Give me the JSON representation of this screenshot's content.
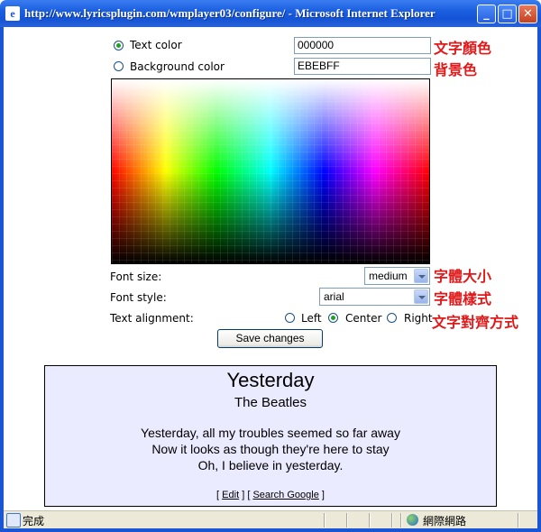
{
  "window": {
    "title": "http://www.lyricsplugin.com/wmplayer03/configure/ - Microsoft Internet Explorer",
    "icon": "ie-icon",
    "controls": {
      "minimize": "_",
      "maximize": "□",
      "close": "✕"
    }
  },
  "colors": {
    "text_color_label": "Text color",
    "text_color_value": "000000",
    "bg_color_label": "Background color",
    "bg_color_value": "EBEBFF",
    "text_color_selected": true
  },
  "font": {
    "size_label": "Font size:",
    "size_value": "medium",
    "style_label": "Font style:",
    "style_value": "arial",
    "align_label": "Text alignment:",
    "align_options": [
      "Left",
      "Center",
      "Right"
    ],
    "align_selected": "Center"
  },
  "save_button": "Save changes",
  "annotations": {
    "text_color": "文字顏色",
    "bg_color": "背景色",
    "font_size": "字體大小",
    "font_style": "字體樣式",
    "text_align": "文字對齊方式"
  },
  "preview": {
    "title": "Yesterday",
    "artist": "The Beatles",
    "lines": [
      "Yesterday, all my troubles seemed so far away",
      "Now it looks as though they're here to stay",
      "Oh, I believe in yesterday."
    ],
    "links_open": "[",
    "edit_link": "Edit",
    "links_mid": "] [",
    "search_link": "Search Google",
    "links_close": "]"
  },
  "statusbar": {
    "status": "完成",
    "zone": "網際網路"
  },
  "accent": "#1a56d4",
  "annotation_color": "#e0191a",
  "preview_bg": "#ebebff"
}
